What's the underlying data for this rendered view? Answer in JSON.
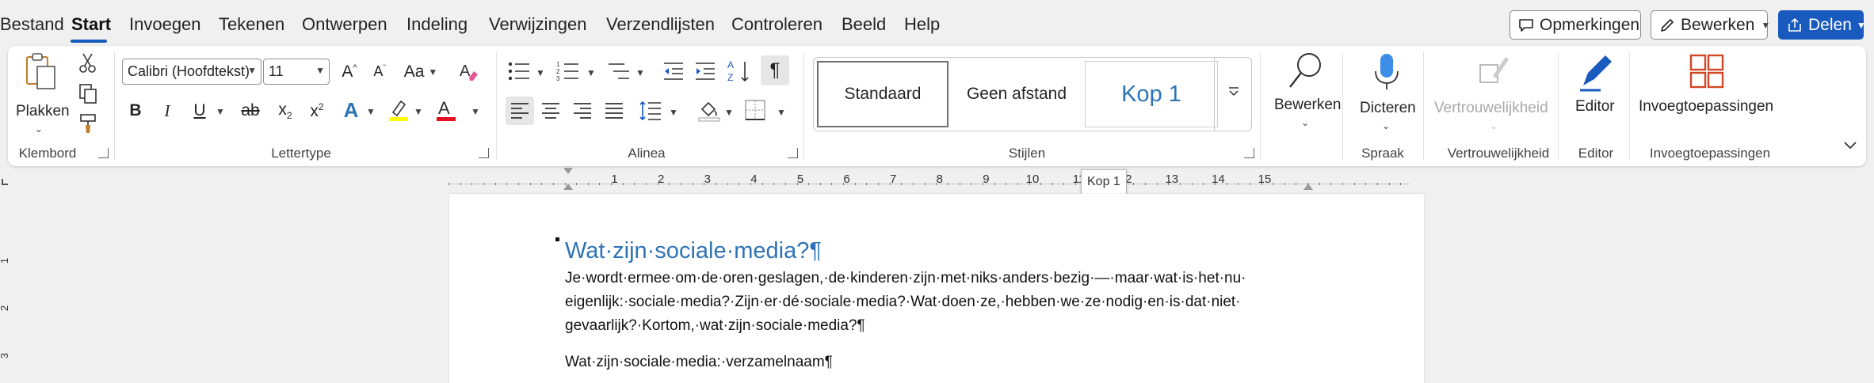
{
  "menu": {
    "tabs": [
      "Bestand",
      "Start",
      "Invoegen",
      "Tekenen",
      "Ontwerpen",
      "Indeling",
      "Verwijzingen",
      "Verzendlijsten",
      "Controleren",
      "Beeld",
      "Help"
    ],
    "active_tab": "Start",
    "comments_label": "Opmerkingen",
    "edit_label": "Bewerken",
    "share_label": "Delen"
  },
  "ribbon": {
    "clipboard": {
      "paste_label": "Plakken",
      "group_label": "Klembord"
    },
    "font": {
      "font_name": "Calibri (Hoofdtekst)",
      "font_size": "11",
      "case_label": "Aa",
      "group_label": "Lettertype",
      "highlight_color": "#ffff00",
      "font_color": "#e81123"
    },
    "paragraph": {
      "group_label": "Alinea"
    },
    "styles": {
      "items": [
        "Standaard",
        "Geen afstand",
        "Kop 1"
      ],
      "group_label": "Stijlen"
    },
    "editing": {
      "label": "Bewerken"
    },
    "voice": {
      "label": "Dicteren",
      "group_label": "Spraak"
    },
    "sensitivity": {
      "label": "Vertrouwelijkheid",
      "group_label": "Vertrouwelijkheid"
    },
    "editor": {
      "label": "Editor",
      "group_label": "Editor"
    },
    "addins": {
      "label": "Invoegtoepassingen",
      "group_label": "Invoegtoepassingen"
    }
  },
  "ruler": {
    "numbers": [
      "1",
      "2",
      "3",
      "4",
      "5",
      "6",
      "7",
      "8",
      "9",
      "10",
      "11",
      "12",
      "13",
      "14",
      "15"
    ],
    "tooltip": "Kop 1",
    "vertical_numbers": [
      "1",
      "2",
      "3"
    ]
  },
  "document": {
    "heading": "Wat·zijn·sociale·media?¶",
    "paragraph_lines": [
      "Je·wordt·ermee·om·de·oren·geslagen,·de·kinderen·zijn·met·niks·anders·bezig·—·maar·wat·is·het·nu·",
      "eigenlijk:·sociale·media?·Zijn·er·dé·sociale·media?·Wat·doen·ze,·hebben·we·ze·nodig·en·is·dat·niet·",
      "gevaarlijk?·Kortom,·wat·zijn·sociale·media?¶"
    ],
    "second_paragraph": "Wat·zijn·sociale·media:·verzamelnaam¶"
  },
  "colors": {
    "accent": "#185abd",
    "heading": "#2e74b5"
  }
}
